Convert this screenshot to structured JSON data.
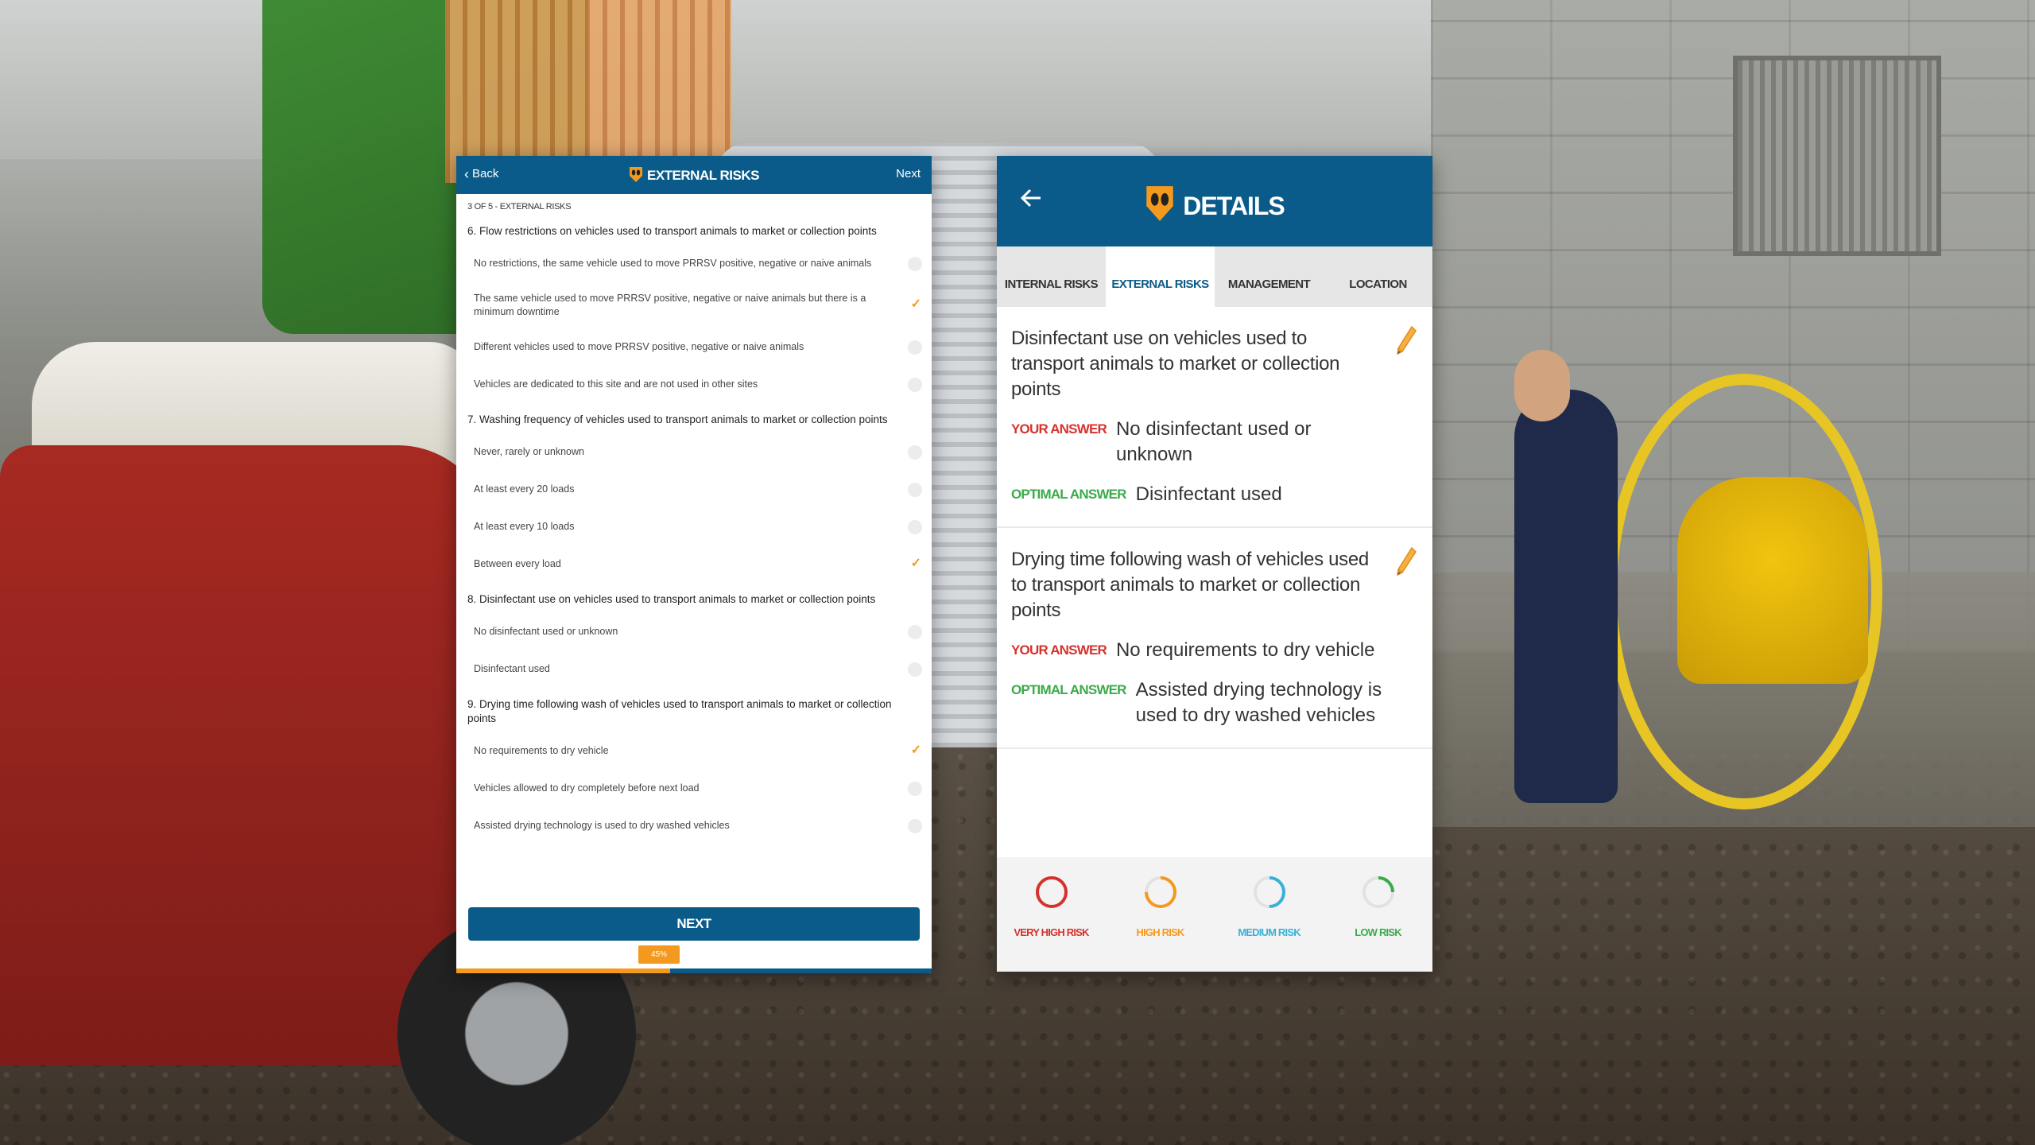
{
  "left_screen": {
    "header": {
      "back_label": "Back",
      "title": "EXTERNAL RISKS",
      "next_label": "Next"
    },
    "progress_label": "3 OF 5 - EXTERNAL RISKS",
    "questions": [
      {
        "title": "6. Flow restrictions on vehicles used to transport animals to market or collection points",
        "options": [
          {
            "label": "No restrictions, the same vehicle used to move PRRSV positive, negative or naive animals",
            "selected": false
          },
          {
            "label": "The same vehicle used to move PRRSV positive, negative or naive animals but there is a minimum downtime",
            "selected": true
          },
          {
            "label": "Different vehicles used to move PRRSV positive, negative or naive animals",
            "selected": false
          },
          {
            "label": "Vehicles are dedicated to this site and are not used in other sites",
            "selected": false
          }
        ]
      },
      {
        "title": "7. Washing frequency of vehicles used to transport animals to market or collection points",
        "options": [
          {
            "label": "Never, rarely or unknown",
            "selected": false
          },
          {
            "label": "At least every 20 loads",
            "selected": false
          },
          {
            "label": "At least every 10 loads",
            "selected": false
          },
          {
            "label": "Between every load",
            "selected": true
          }
        ]
      },
      {
        "title": "8. Disinfectant use on vehicles used to transport animals to market or collection points",
        "options": [
          {
            "label": "No disinfectant used or unknown",
            "selected": false
          },
          {
            "label": "Disinfectant used",
            "selected": false
          }
        ]
      },
      {
        "title": "9. Drying time following wash of vehicles used to transport animals to market or collection points",
        "options": [
          {
            "label": "No requirements to dry vehicle",
            "selected": true
          },
          {
            "label": "Vehicles allowed to dry completely before next load",
            "selected": false
          },
          {
            "label": "Assisted drying technology is used to dry washed vehicles",
            "selected": false
          }
        ]
      }
    ],
    "next_button_label": "NEXT",
    "progress_percent_label": "45%",
    "progress_fraction": 0.45
  },
  "right_screen": {
    "header": {
      "title": "DETAILS"
    },
    "tabs": [
      {
        "label": "INTERNAL RISKS",
        "active": false
      },
      {
        "label": "EXTERNAL RISKS",
        "active": true
      },
      {
        "label": "MANAGEMENT",
        "active": false
      },
      {
        "label": "LOCATION",
        "active": false
      }
    ],
    "your_answer_label": "YOUR ANSWER",
    "optimal_answer_label": "OPTIMAL ANSWER",
    "cards": [
      {
        "question": "Disinfectant use on vehicles used to transport animals to market or collection points",
        "your_answer": "No disinfectant used or unknown",
        "optimal_answer": "Disinfectant used"
      },
      {
        "question": "Drying time following wash of vehicles used to transport animals to market or collection points",
        "your_answer": "No requirements to dry vehicle",
        "optimal_answer": "Assisted drying technology is used to dry washed vehicles"
      }
    ],
    "legend": [
      {
        "label": "VERY HIGH RISK",
        "color": "#d6322d",
        "fill": 1.0
      },
      {
        "label": "HIGH RISK",
        "color": "#f39a1e",
        "fill": 0.75
      },
      {
        "label": "MEDIUM RISK",
        "color": "#3ab0d8",
        "fill": 0.5
      },
      {
        "label": "LOW RISK",
        "color": "#3aab4a",
        "fill": 0.25
      }
    ]
  },
  "colors": {
    "brand_blue": "#0b5b8a",
    "accent_orange": "#f39a1e",
    "your_answer_red": "#d6322d",
    "optimal_green": "#3aab4a"
  }
}
